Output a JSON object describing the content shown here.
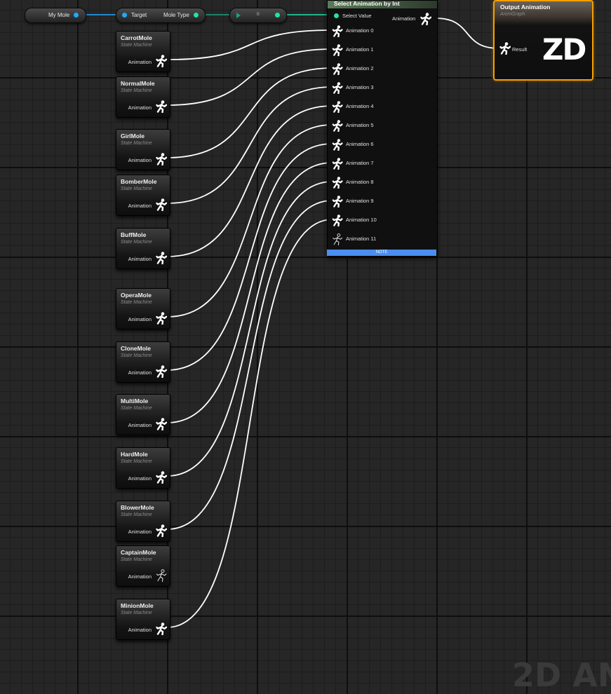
{
  "top_bar": {
    "variable_label": "My Mole",
    "getter_target_label": "Target",
    "getter_output_label": "Mole Type",
    "cast_label": "B"
  },
  "state_machines": [
    {
      "title": "CarrotMole",
      "subtitle": "State Machine",
      "pin": "Animation",
      "icon": "running-man-icon"
    },
    {
      "title": "NormalMole",
      "subtitle": "State Machine",
      "pin": "Animation",
      "icon": "running-man-icon"
    },
    {
      "title": "GirlMole",
      "subtitle": "State Machine",
      "pin": "Animation",
      "icon": "running-man-icon"
    },
    {
      "title": "BomberMole",
      "subtitle": "State Machine",
      "pin": "Animation",
      "icon": "running-man-icon"
    },
    {
      "title": "BuffMole",
      "subtitle": "State Machine",
      "pin": "Animation",
      "icon": "running-man-icon"
    },
    {
      "title": "OperaMole",
      "subtitle": "State Machine",
      "pin": "Animation",
      "icon": "running-man-icon"
    },
    {
      "title": "CloneMole",
      "subtitle": "State Machine",
      "pin": "Animation",
      "icon": "running-man-icon"
    },
    {
      "title": "MultiMole",
      "subtitle": "State Machine",
      "pin": "Animation",
      "icon": "running-man-icon"
    },
    {
      "title": "HardMole",
      "subtitle": "State Machine",
      "pin": "Animation",
      "icon": "running-man-icon"
    },
    {
      "title": "BlowerMole",
      "subtitle": "State Machine",
      "pin": "Animation",
      "icon": "running-man-icon"
    },
    {
      "title": "CaptainMole",
      "subtitle": "State Machine",
      "pin": "Animation",
      "icon": "running-man-icon"
    },
    {
      "title": "MinionMole",
      "subtitle": "State Machine",
      "pin": "Animation",
      "icon": "running-man-icon"
    }
  ],
  "select_node": {
    "title": "Select Animation by Int",
    "select_value_label": "Select Value",
    "output_label": "Animation",
    "inputs": [
      "Animation 0",
      "Animation 1",
      "Animation 2",
      "Animation 3",
      "Animation 4",
      "Animation 5",
      "Animation 6",
      "Animation 7",
      "Animation 8",
      "Animation 9",
      "Animation 10",
      "Animation 11"
    ],
    "note_label": "NOTE"
  },
  "output_node": {
    "title": "Output Animation",
    "subtitle": "AnimGraph",
    "pin_label": "Result",
    "logo_text": "ZD"
  },
  "watermark": "2D AN",
  "colors": {
    "object_pin": "#20a8ff",
    "enum_pin": "#24e0a8",
    "wire": "#ffffff",
    "output_border": "#f5a000",
    "note_bar": "#4a8ef0"
  }
}
